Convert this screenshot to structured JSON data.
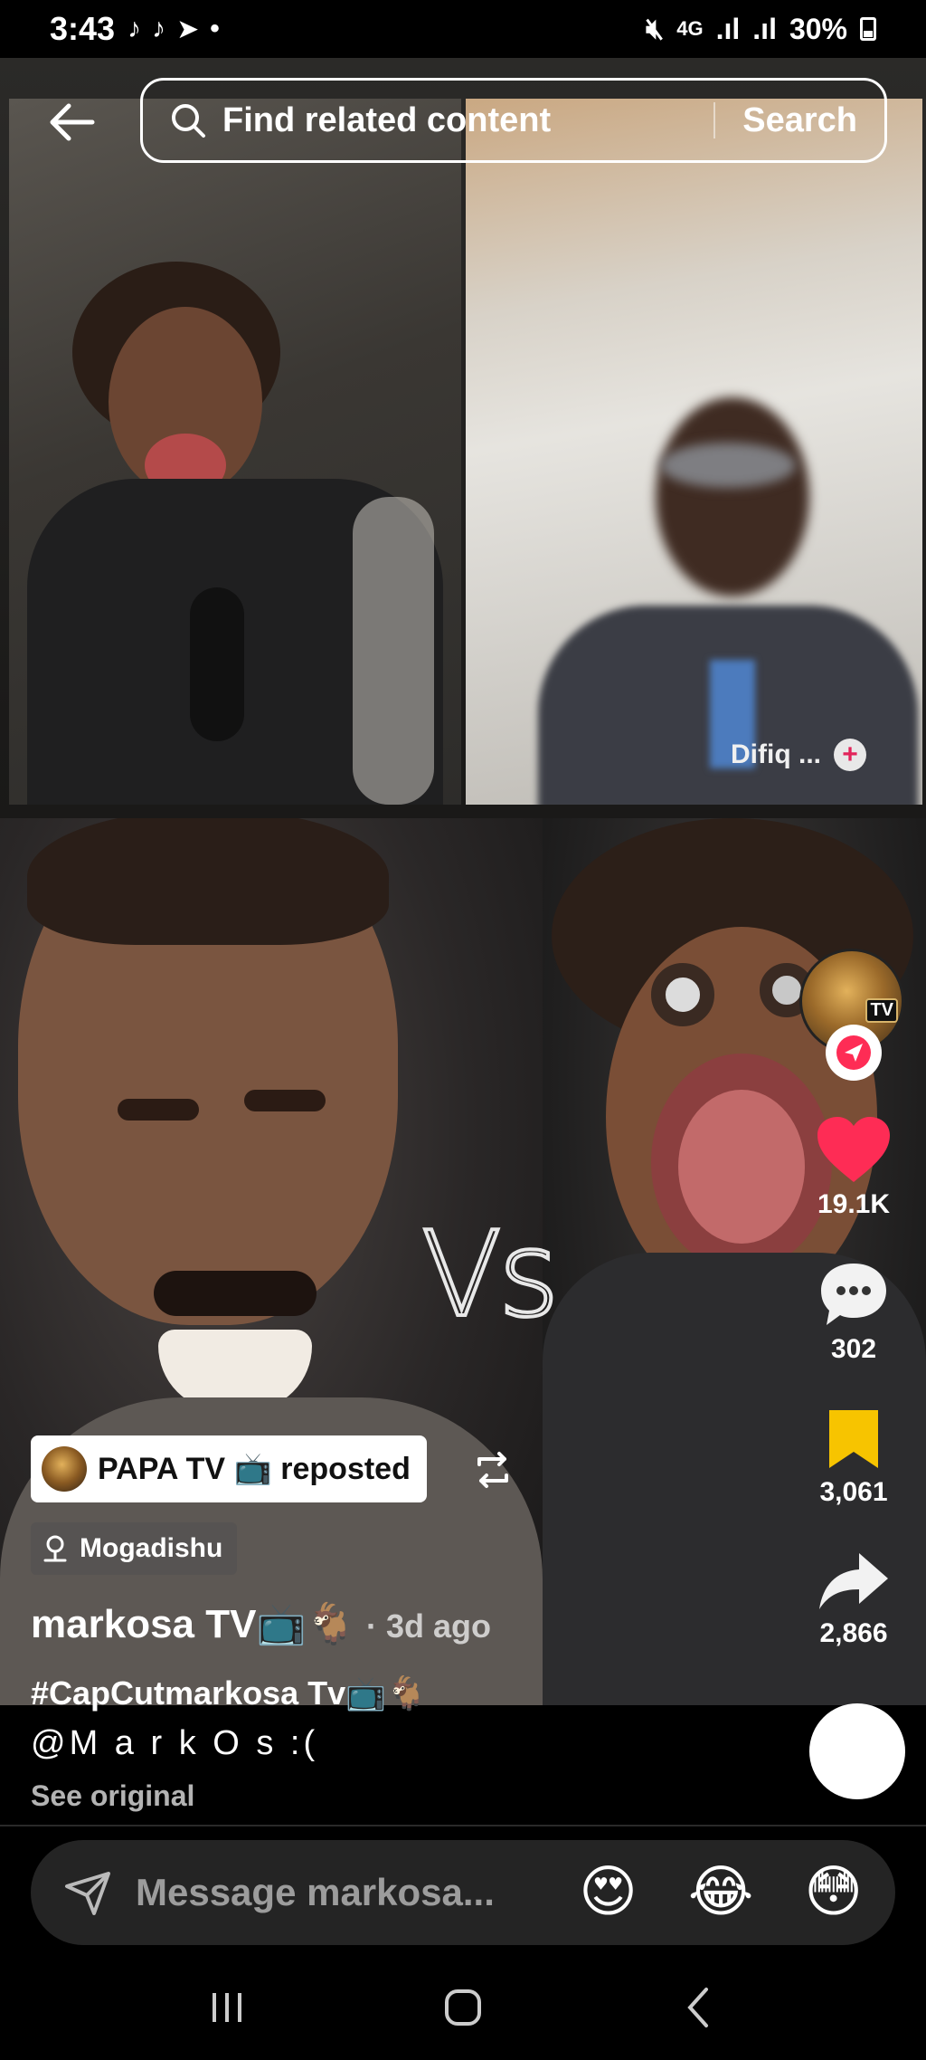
{
  "status_bar": {
    "time": "3:43",
    "network": "4G",
    "battery": "30%"
  },
  "search": {
    "placeholder": "Find related content",
    "button_label": "Search"
  },
  "video": {
    "vs_text": "Vs",
    "overlay_user": "Difiq ..."
  },
  "rail": {
    "likes": "19.1K",
    "comments": "302",
    "saves": "3,061",
    "shares": "2,866",
    "avatar_badge": "TV"
  },
  "post": {
    "repost_label": "PAPA TV 📺 reposted",
    "location": "Mogadishu",
    "username": "markosa TV📺🐐",
    "time_ago": "· 3d ago",
    "caption_line1": "#CapCutmarkosa Tv📺🐐",
    "caption_line2": "@M a r k O s :(",
    "see_original": "See original"
  },
  "message": {
    "placeholder": "Message markosa...",
    "quick_emojis": [
      "😍",
      "😂",
      "😳"
    ]
  },
  "sound_emoji": "😂",
  "colors": {
    "like": "#fe2c55",
    "save": "#f7c400",
    "follow": "#fe2c55"
  }
}
